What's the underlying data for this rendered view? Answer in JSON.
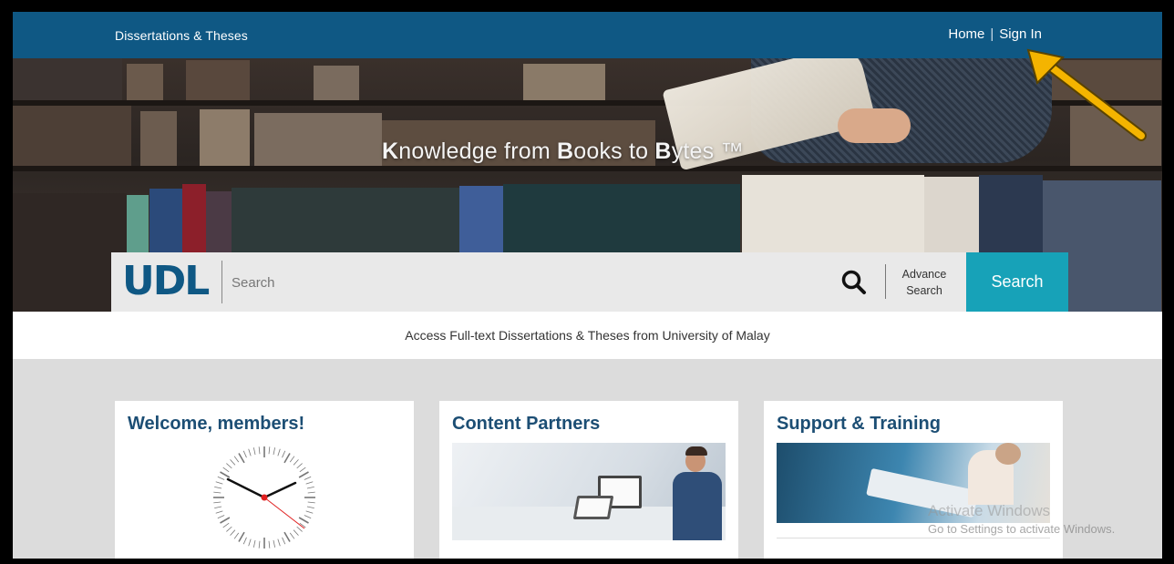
{
  "header": {
    "brand": "Dissertations & Theses",
    "nav": {
      "home": "Home",
      "separator": "|",
      "sign_in": "Sign In"
    }
  },
  "hero": {
    "title_parts": [
      "K",
      "nowledge from ",
      "B",
      "ooks to ",
      "B",
      "ytes ™"
    ]
  },
  "search": {
    "logo": "UDL",
    "placeholder": "Search",
    "advance_line1": "Advance",
    "advance_line2": "Search",
    "button": "Search"
  },
  "tagline": "Access Full-text Dissertations & Theses from University of Malay",
  "cards": [
    {
      "title": "Welcome, members!"
    },
    {
      "title": "Content Partners"
    },
    {
      "title": "Support & Training"
    }
  ],
  "watermark": {
    "line1": "Activate Windows",
    "line2": "Go to Settings to activate Windows."
  },
  "colors": {
    "topbar": "#0f5884",
    "search_button": "#17a2b8",
    "card_title": "#1c4e74",
    "annotation_arrow": "#f4b400"
  },
  "icons": [
    "search-icon",
    "udl-logo",
    "clock-icon",
    "annotation-arrow-icon"
  ]
}
